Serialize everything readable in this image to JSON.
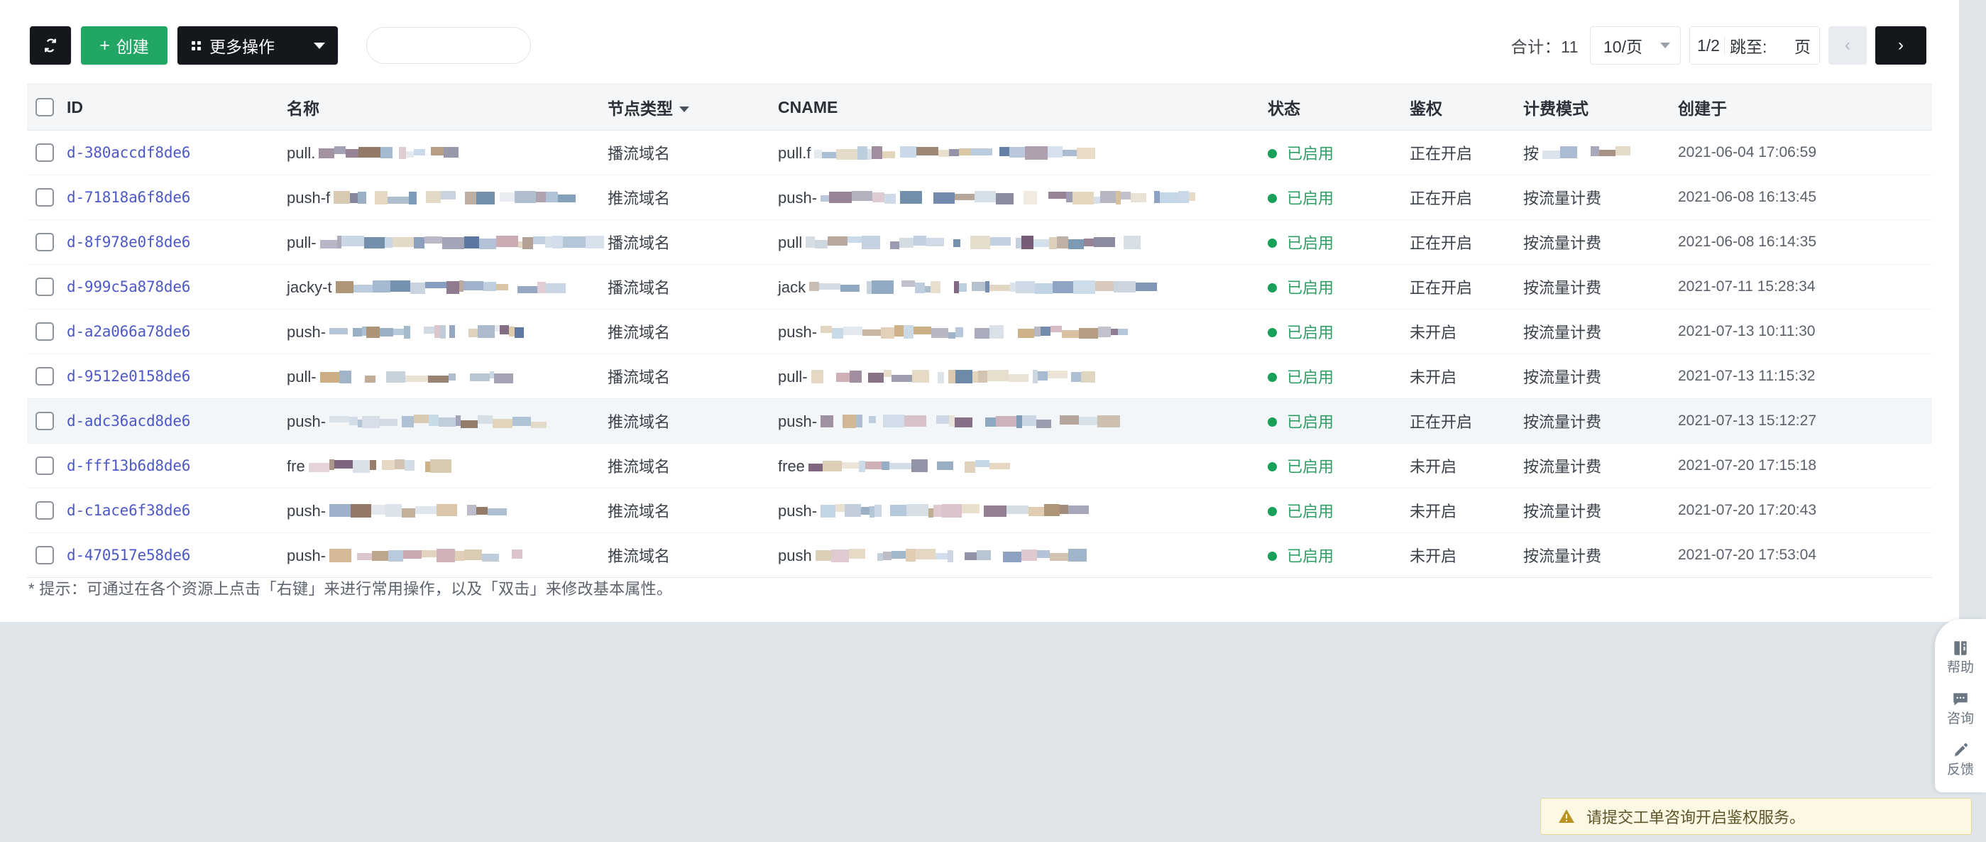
{
  "toolbar": {
    "refresh_icon": "refresh-icon",
    "create_label": "创建",
    "create_plus": "+",
    "more_actions_label": "更多操作",
    "search_value": "",
    "search_placeholder": ""
  },
  "pagination": {
    "total_label": "合计：11",
    "page_size": "10/页",
    "page_fraction": "1/2",
    "jump_label": "跳至:",
    "jump_value": "",
    "jump_unit": "页",
    "prev_glyph": "‹",
    "next_glyph": "›"
  },
  "table": {
    "columns": [
      {
        "key": "checkbox",
        "label": ""
      },
      {
        "key": "id",
        "label": "ID"
      },
      {
        "key": "name",
        "label": "名称"
      },
      {
        "key": "type",
        "label": "节点类型",
        "sortable": true
      },
      {
        "key": "cname",
        "label": "CNAME"
      },
      {
        "key": "status",
        "label": "状态"
      },
      {
        "key": "auth",
        "label": "鉴权"
      },
      {
        "key": "billing",
        "label": "计费模式"
      },
      {
        "key": "created",
        "label": "创建于"
      }
    ],
    "rows": [
      {
        "id": "d-380accdf8de6",
        "name_prefix": "pull.",
        "type": "播流域名",
        "cname_prefix": "pull.f",
        "status": "已启用",
        "auth": "正在开启",
        "billing": "按",
        "billing_redacted": true,
        "created": "2021-06-04 17:06:59",
        "highlighted": false
      },
      {
        "id": "d-71818a6f8de6",
        "name_prefix": "push-f",
        "type": "推流域名",
        "cname_prefix": "push-",
        "status": "已启用",
        "auth": "正在开启",
        "billing": "按流量计费",
        "billing_redacted": false,
        "created": "2021-06-08 16:13:45",
        "highlighted": false
      },
      {
        "id": "d-8f978e0f8de6",
        "name_prefix": "pull-",
        "type": "播流域名",
        "cname_prefix": "pull",
        "status": "已启用",
        "auth": "正在开启",
        "billing": "按流量计费",
        "billing_redacted": false,
        "created": "2021-06-08 16:14:35",
        "highlighted": false
      },
      {
        "id": "d-999c5a878de6",
        "name_prefix": "jacky-t",
        "type": "播流域名",
        "cname_prefix": "jack",
        "status": "已启用",
        "auth": "正在开启",
        "billing": "按流量计费",
        "billing_redacted": false,
        "created": "2021-07-11 15:28:34",
        "highlighted": false
      },
      {
        "id": "d-a2a066a78de6",
        "name_prefix": "push-",
        "type": "推流域名",
        "cname_prefix": "push-",
        "status": "已启用",
        "auth": "未开启",
        "billing": "按流量计费",
        "billing_redacted": false,
        "created": "2021-07-13 10:11:30",
        "highlighted": false
      },
      {
        "id": "d-9512e0158de6",
        "name_prefix": "pull-",
        "type": "播流域名",
        "cname_prefix": "pull-",
        "status": "已启用",
        "auth": "未开启",
        "billing": "按流量计费",
        "billing_redacted": false,
        "created": "2021-07-13 11:15:32",
        "highlighted": false
      },
      {
        "id": "d-adc36acd8de6",
        "name_prefix": "push-",
        "type": "推流域名",
        "cname_prefix": "push-",
        "status": "已启用",
        "auth": "正在开启",
        "billing": "按流量计费",
        "billing_redacted": false,
        "created": "2021-07-13 15:12:27",
        "highlighted": true
      },
      {
        "id": "d-fff13b6d8de6",
        "name_prefix": "fre",
        "type": "推流域名",
        "cname_prefix": "free",
        "status": "已启用",
        "auth": "未开启",
        "billing": "按流量计费",
        "billing_redacted": false,
        "created": "2021-07-20 17:15:18",
        "highlighted": false
      },
      {
        "id": "d-c1ace6f38de6",
        "name_prefix": "push-",
        "type": "推流域名",
        "cname_prefix": "push-",
        "status": "已启用",
        "auth": "未开启",
        "billing": "按流量计费",
        "billing_redacted": false,
        "created": "2021-07-20 17:20:43",
        "highlighted": false
      },
      {
        "id": "d-470517e58de6",
        "name_prefix": "push-",
        "type": "推流域名",
        "cname_prefix": "push",
        "status": "已启用",
        "auth": "未开启",
        "billing": "按流量计费",
        "billing_redacted": false,
        "created": "2021-07-20 17:53:04",
        "highlighted": false
      }
    ]
  },
  "hint": "* 提示：可通过在各个资源上点击「右键」来进行常用操作，以及「双击」来修改基本属性。",
  "dock": {
    "items": [
      {
        "icon": "book-help-icon",
        "label": "帮助"
      },
      {
        "icon": "chat-bubble-icon",
        "label": "咨询"
      },
      {
        "icon": "pencil-feedback-icon",
        "label": "反馈"
      }
    ]
  },
  "toast": {
    "icon": "warning-triangle-icon",
    "message": "请提交工单咨询开启鉴权服务。"
  },
  "colors": {
    "accent_green": "#21a666",
    "dark_button": "#14181c",
    "link_blue": "#4d58c7",
    "status_green": "#2f9e63",
    "toast_bg": "#fdf8e3",
    "toast_border": "#e8d99a",
    "page_bg": "#dfe5e9",
    "header_bg": "#f4f6f8",
    "row_hover": "#f2f6f9"
  }
}
